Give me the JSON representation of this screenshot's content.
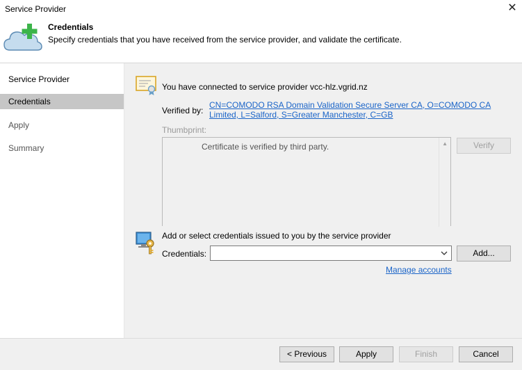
{
  "window": {
    "title": "Service Provider"
  },
  "header": {
    "title": "Credentials",
    "description": "Specify credentials that you have received from the service provider, and validate the certificate."
  },
  "sidebar": {
    "items": [
      {
        "label": "Service Provider",
        "state": "done"
      },
      {
        "label": "Credentials",
        "state": "active"
      },
      {
        "label": "Apply",
        "state": "pending"
      },
      {
        "label": "Summary",
        "state": "pending"
      }
    ]
  },
  "certificate": {
    "connected_text": "You have connected to service provider vcc-hlz.vgrid.nz",
    "verified_label": "Verified by:",
    "verified_link_line1": "CN=COMODO RSA Domain Validation Secure Server CA, O=COMODO CA",
    "verified_link_line2": "Limited, L=Salford, S=Greater Manchester, C=GB",
    "thumbprint_label": "Thumbprint:",
    "thumbprint_text": "Certificate is verified by third party.",
    "verify_button": "Verify"
  },
  "credentials": {
    "heading": "Add or select credentials issued to you by the service provider",
    "label": "Credentials:",
    "selected_value": "",
    "add_button": "Add...",
    "manage_link": "Manage accounts"
  },
  "footer": {
    "previous": "< Previous",
    "apply": "Apply",
    "finish": "Finish",
    "cancel": "Cancel"
  },
  "colors": {
    "link": "#1a64c8",
    "accent_green": "#3cb44a",
    "cloud": "#aecde6"
  }
}
